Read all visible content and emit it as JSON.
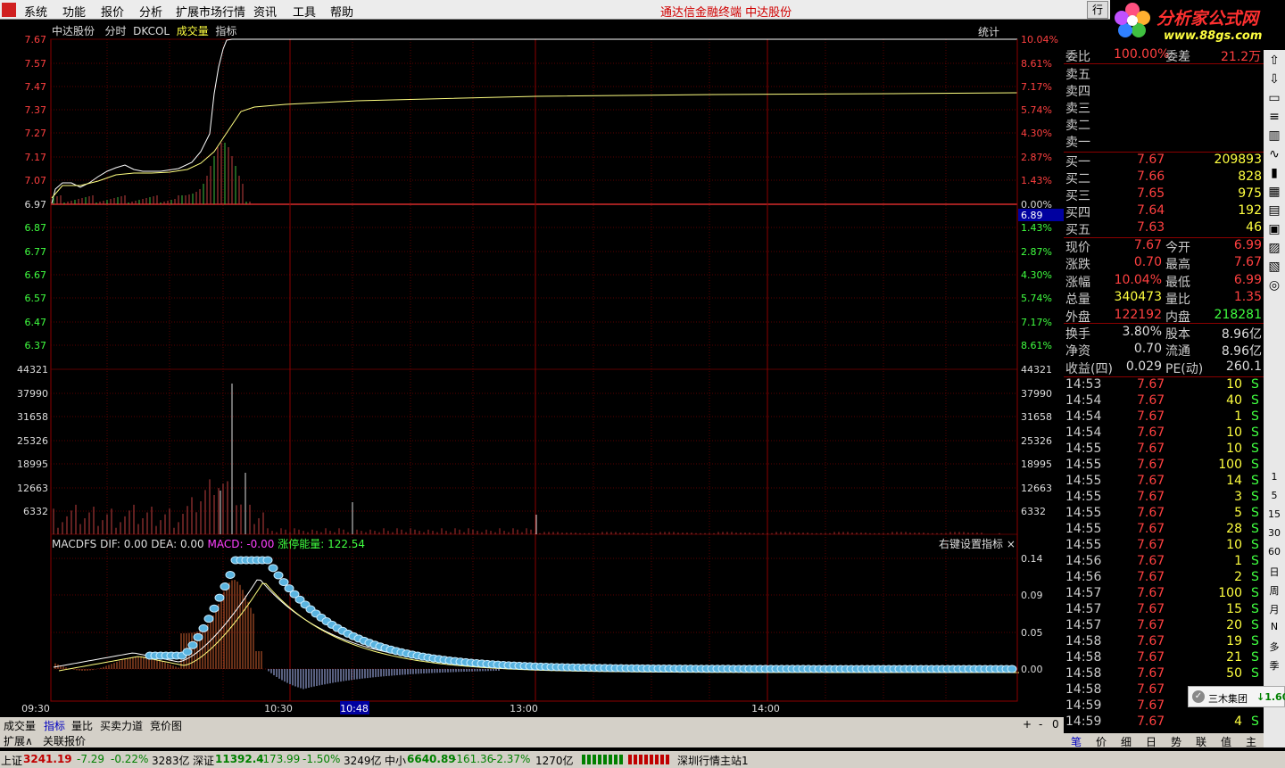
{
  "menu": {
    "items": [
      "系统",
      "功能",
      "报价",
      "分析",
      "扩展市场行情",
      "资讯",
      "工具",
      "帮助"
    ],
    "center": "通达信金融终端  中达股份",
    "right_btn": "行"
  },
  "brand": {
    "title": "分析家公式网",
    "url": "www.88gs.com"
  },
  "chart_header": {
    "stock": "中达股份",
    "mode": "分时",
    "indicator": "DKCOL",
    "volume": "成交量",
    "index": "指标",
    "stats": "统计"
  },
  "price_axis": {
    "left": [
      "7.67",
      "7.57",
      "7.47",
      "7.37",
      "7.27",
      "7.17",
      "7.07",
      "6.97",
      "6.87",
      "6.77",
      "6.67",
      "6.57",
      "6.47",
      "6.37"
    ],
    "right": [
      "10.04%",
      "8.61%",
      "7.17%",
      "5.74%",
      "4.30%",
      "2.87%",
      "1.43%",
      "0.00%",
      "1.43%",
      "2.87%",
      "4.30%",
      "5.74%",
      "7.17%",
      "8.61%"
    ],
    "cursor_value": "6.89"
  },
  "volume_axis": [
    "44321",
    "37990",
    "31658",
    "25326",
    "18995",
    "12663",
    "6332"
  ],
  "macd_header": {
    "name": "MACDFS",
    "dif": "DIF: 0.00",
    "dea": "DEA: 0.00",
    "macd": "MACD: -0.00",
    "energy": "涨停能量: 122.54",
    "right_click": "右键设置指标 ×"
  },
  "macd_axis": [
    "0.14",
    "0.09",
    "0.05",
    "0.00"
  ],
  "time_axis": [
    "09:30",
    "10:30",
    "10:48",
    "13:00",
    "14:00"
  ],
  "bottom_tabs": [
    "成交量",
    "指标",
    "量比",
    "买卖力道",
    "竞价图"
  ],
  "bottom_right": [
    "+",
    "-",
    "0"
  ],
  "bottom_tabs2": [
    "扩展∧",
    "关联报价"
  ],
  "status": {
    "sh_label": "上证",
    "sh_val": "3241.19",
    "sh_chg": "-7.29",
    "sh_pct": "-0.22%",
    "sh_amt": "3283亿",
    "sz_label": "深证",
    "sz_val": "11392.4",
    "sz_chg": "-173.99",
    "sz_pct": "-1.50%",
    "sz_amt": "3249亿",
    "zx_label": "中小",
    "zx_val": "6640.89",
    "zx_chg": "-161.36",
    "zx_pct": "-2.37%",
    "zx_amt": "1270亿",
    "server": "深圳行情主站1"
  },
  "panel": {
    "weibi": {
      "label": "委比",
      "val": "100.00%",
      "label2": "委差",
      "val2": "21.2万"
    },
    "sells": [
      "卖五",
      "卖四",
      "卖三",
      "卖二",
      "卖一"
    ],
    "buys": [
      {
        "label": "买一",
        "price": "7.67",
        "vol": "209893"
      },
      {
        "label": "买二",
        "price": "7.66",
        "vol": "828"
      },
      {
        "label": "买三",
        "price": "7.65",
        "vol": "975"
      },
      {
        "label": "买四",
        "price": "7.64",
        "vol": "192"
      },
      {
        "label": "买五",
        "price": "7.63",
        "vol": "46"
      }
    ],
    "quote": [
      {
        "l1": "现价",
        "v1": "7.67",
        "l2": "今开",
        "v2": "6.99"
      },
      {
        "l1": "涨跌",
        "v1": "0.70",
        "l2": "最高",
        "v2": "7.67"
      },
      {
        "l1": "涨幅",
        "v1": "10.04%",
        "l2": "最低",
        "v2": "6.99"
      },
      {
        "l1": "总量",
        "v1": "340473",
        "l2": "量比",
        "v2": "1.35"
      },
      {
        "l1": "外盘",
        "v1": "122192",
        "l2": "内盘",
        "v2": "218281"
      },
      {
        "l1": "换手",
        "v1": "3.80%",
        "l2": "股本",
        "v2": "8.96亿"
      },
      {
        "l1": "净资",
        "v1": "0.70",
        "l2": "流通",
        "v2": "8.96亿"
      },
      {
        "l1": "收益(四)",
        "v1": "0.029",
        "l2": "PE(动)",
        "v2": "260.1"
      }
    ],
    "ticks": [
      {
        "t": "14:53",
        "p": "7.67",
        "v": "10",
        "s": "S"
      },
      {
        "t": "14:54",
        "p": "7.67",
        "v": "40",
        "s": "S"
      },
      {
        "t": "14:54",
        "p": "7.67",
        "v": "1",
        "s": "S"
      },
      {
        "t": "14:54",
        "p": "7.67",
        "v": "10",
        "s": "S"
      },
      {
        "t": "14:55",
        "p": "7.67",
        "v": "10",
        "s": "S"
      },
      {
        "t": "14:55",
        "p": "7.67",
        "v": "100",
        "s": "S"
      },
      {
        "t": "14:55",
        "p": "7.67",
        "v": "14",
        "s": "S"
      },
      {
        "t": "14:55",
        "p": "7.67",
        "v": "3",
        "s": "S"
      },
      {
        "t": "14:55",
        "p": "7.67",
        "v": "5",
        "s": "S"
      },
      {
        "t": "14:55",
        "p": "7.67",
        "v": "28",
        "s": "S"
      },
      {
        "t": "14:55",
        "p": "7.67",
        "v": "10",
        "s": "S"
      },
      {
        "t": "14:56",
        "p": "7.67",
        "v": "1",
        "s": "S"
      },
      {
        "t": "14:56",
        "p": "7.67",
        "v": "2",
        "s": "S"
      },
      {
        "t": "14:57",
        "p": "7.67",
        "v": "100",
        "s": "S"
      },
      {
        "t": "14:57",
        "p": "7.67",
        "v": "15",
        "s": "S"
      },
      {
        "t": "14:57",
        "p": "7.67",
        "v": "20",
        "s": "S"
      },
      {
        "t": "14:58",
        "p": "7.67",
        "v": "19",
        "s": "S"
      },
      {
        "t": "14:58",
        "p": "7.67",
        "v": "21",
        "s": "S"
      },
      {
        "t": "14:58",
        "p": "7.67",
        "v": "50",
        "s": "S"
      },
      {
        "t": "14:58",
        "p": "7.67",
        "v": "",
        "s": ""
      },
      {
        "t": "14:59",
        "p": "7.67",
        "v": "",
        "s": ""
      },
      {
        "t": "14:59",
        "p": "7.67",
        "v": "4",
        "s": "S"
      }
    ]
  },
  "panel_tabs": [
    "笔",
    "价",
    "细",
    "日",
    "势",
    "联",
    "值",
    "主"
  ],
  "toolstrip": [
    "1",
    "5",
    "15",
    "30",
    "60",
    "日",
    "周",
    "月",
    "N",
    "多",
    "季"
  ],
  "popup": {
    "text": "三木集团",
    "val": "↓1.60"
  },
  "colors": {
    "up": "#ff4040",
    "down": "#40ff40",
    "grid": "#8b0000",
    "label": "#c0c0c0",
    "yellow": "#ffff40"
  }
}
